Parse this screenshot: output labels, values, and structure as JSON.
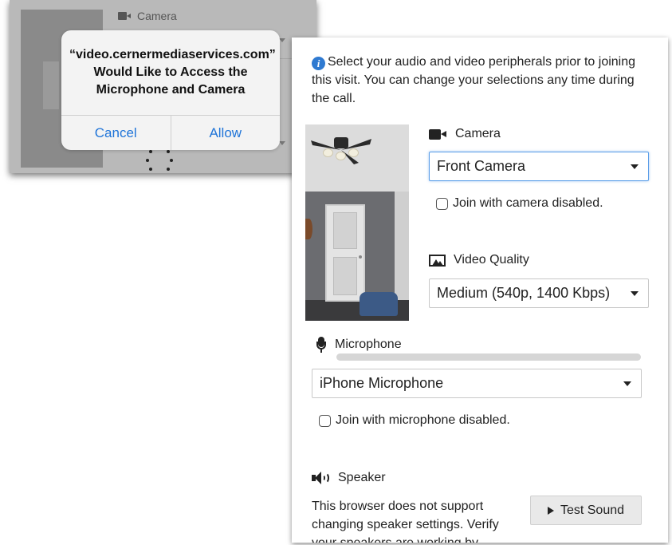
{
  "background": {
    "camera_label": "Camera",
    "partial_text": "d."
  },
  "permission_alert": {
    "title": "“video.cernermediaservices.com” Would Like to Access the Microphone and Camera",
    "cancel_label": "Cancel",
    "allow_label": "Allow"
  },
  "panel": {
    "intro_text": "Select your audio and video peripherals prior to joining this visit. You can change your selections any time during the call.",
    "camera": {
      "label": "Camera",
      "selected": "Front Camera",
      "disable_label": "Join with camera disabled."
    },
    "video_quality": {
      "label": "Video Quality",
      "selected": "Medium (540p, 1400 Kbps)"
    },
    "microphone": {
      "label": "Microphone",
      "selected": "iPhone Microphone",
      "disable_label": "Join with microphone disabled."
    },
    "speaker": {
      "label": "Speaker",
      "note": "This browser does not support changing speaker settings. Verify your speakers are working by",
      "test_button_label": "Test Sound"
    }
  },
  "colors": {
    "ios_button_blue": "#1f74d8",
    "info_icon_blue": "#2f7ad1",
    "focus_border": "#5b9ee8"
  }
}
